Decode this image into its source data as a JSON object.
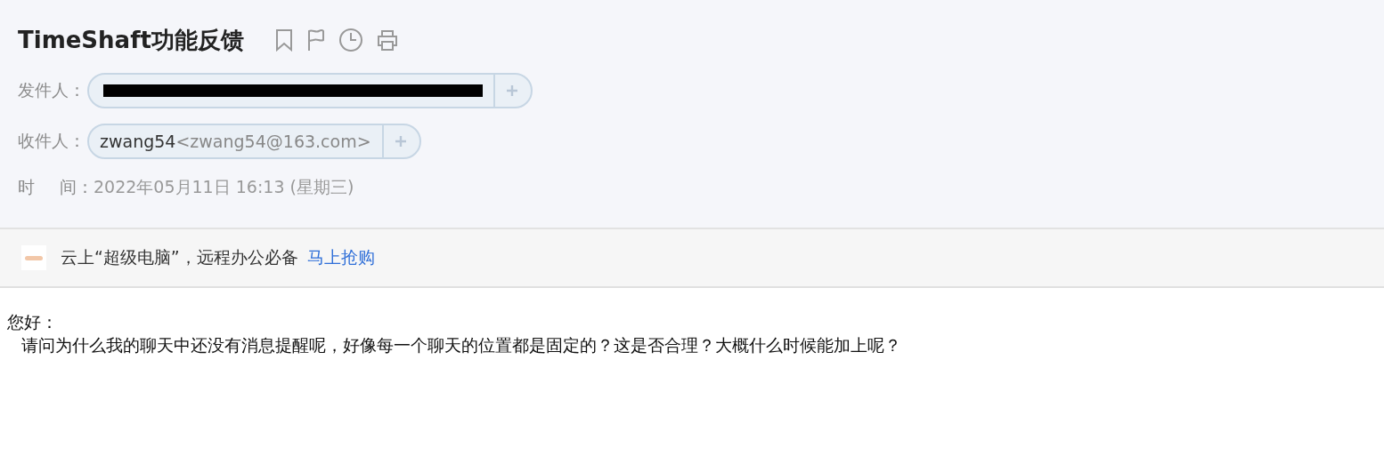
{
  "header": {
    "title": "TimeShaft功能反馈",
    "sender": {
      "label": "发件人："
    },
    "recipient": {
      "label": "收件人：",
      "name": "zwang54",
      "address": "<zwang54@163.com>"
    },
    "time": {
      "label_1": "时",
      "label_2": "间：",
      "value": "2022年05月11日 16:13 (星期三)"
    }
  },
  "ad": {
    "text": "云上“超级电脑”，远程办公必备",
    "link": "马上抢购"
  },
  "body": {
    "lines": [
      "您好：",
      "请问为什么我的聊天中还没有消息提醒呢，好像每一个聊天的位置都是固定的？这是否合理？大概什么时候能加上呢？"
    ]
  }
}
